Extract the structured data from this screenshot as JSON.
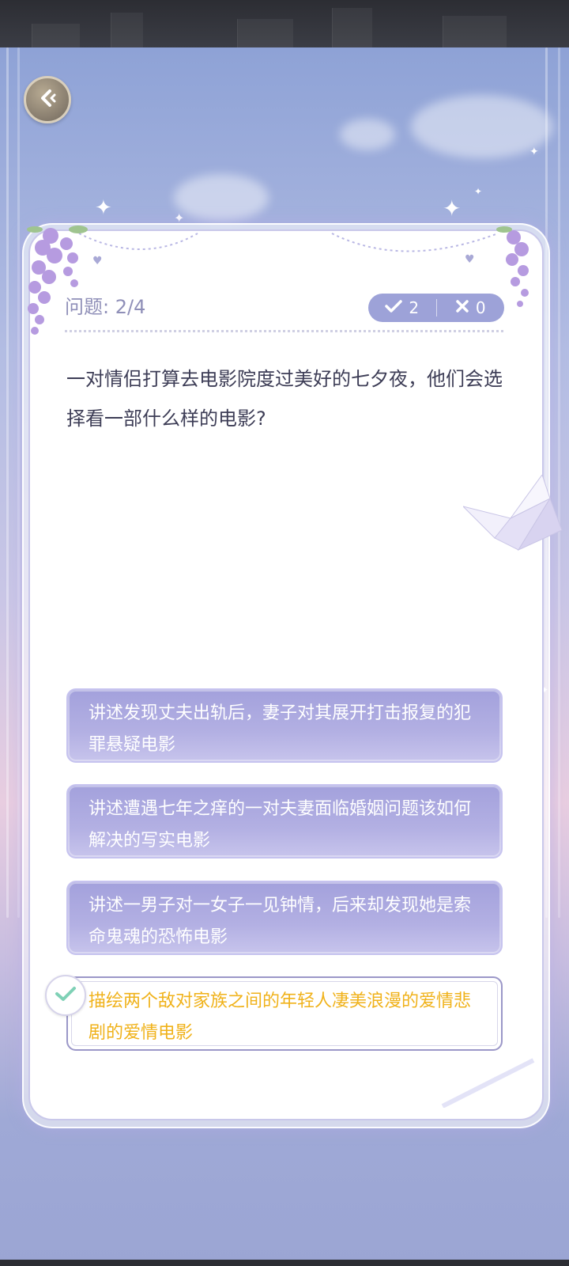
{
  "header": {
    "back_icon": "back-arrow-icon"
  },
  "quiz": {
    "question_counter": "问题: 2/4",
    "correct_count": "2",
    "wrong_count": "0",
    "question_text": "一对情侣打算去电影院度过美好的七夕夜，他们会选择看一部什么样的电影?",
    "options": [
      {
        "label": "讲述发现丈夫出轨后，妻子对其展开打击报复的犯罪悬疑电影",
        "selected": false
      },
      {
        "label": "讲述遭遇七年之痒的一对夫妻面临婚姻问题该如何解决的写实电影",
        "selected": false
      },
      {
        "label": "讲述一男子对一女子一见钟情，后来却发现她是索命鬼魂的恐怖电影",
        "selected": false
      },
      {
        "label": "描绘两个敌对家族之间的年轻人凄美浪漫的爱情悲剧的爱情电影",
        "selected": true
      }
    ]
  },
  "colors": {
    "option_bg": "#a3a1dc",
    "selected_text": "#f0b21a",
    "check_color": "#7fd1b6",
    "pill_bg": "#9da2d8"
  }
}
